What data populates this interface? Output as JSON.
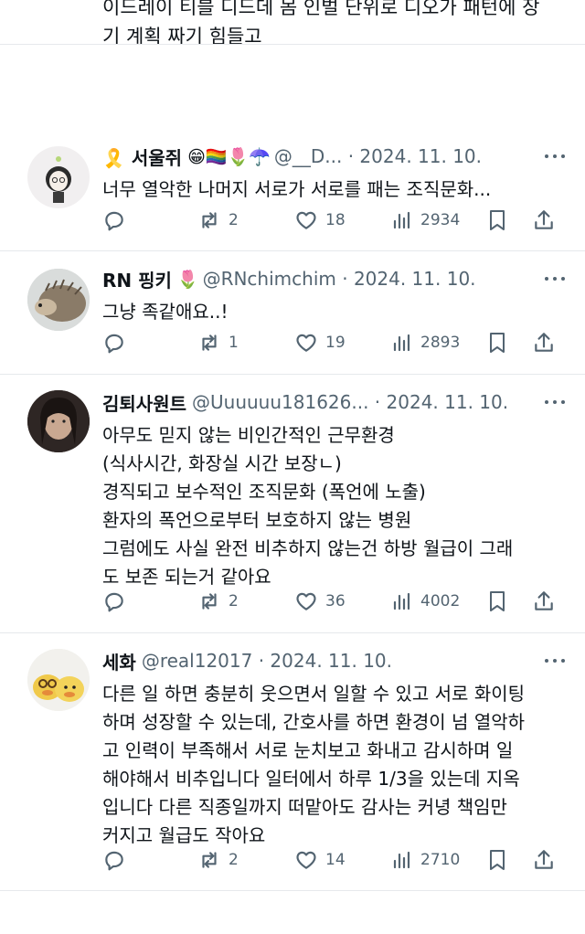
{
  "top_fragment": {
    "line1": "이드레이 티블 디드데 몸 인벌 단위로 디오가 패턴에 장",
    "line2": "기 계획 짜기 힘들고"
  },
  "tweets": [
    {
      "display_name": "🎗️ 서울쥐",
      "emojis": "😁🏳️‍🌈🌷☂️",
      "handle": "@__D...",
      "date": "2024. 11. 10.",
      "text": "너무 열악한 나머지 서로가 서로를 패는 조직문화...",
      "retweets": "2",
      "likes": "18",
      "views": "2934"
    },
    {
      "display_name": "RN 핑키",
      "emojis": "🌷",
      "handle": "@RNchimchim",
      "date": "2024. 11. 10.",
      "text": "그냥 족같애요..!",
      "retweets": "1",
      "likes": "19",
      "views": "2893"
    },
    {
      "display_name": "김퇴사원트",
      "emojis": "",
      "handle": "@Uuuuuu181626...",
      "date": "2024. 11. 10.",
      "text": "아무도 믿지 않는 비인간적인 근무환경\n(식사시간, 화장실 시간 보장ㄴ)\n경직되고 보수적인 조직문화 (폭언에 노출)\n환자의 폭언으로부터 보호하지 않는 병원\n그럼에도 사실 완전 비추하지 않는건 하방 월급이 그래\n도 보존 되는거 같아요",
      "retweets": "2",
      "likes": "36",
      "views": "4002"
    },
    {
      "display_name": "세화",
      "emojis": "",
      "handle": "@real12017",
      "date": "2024. 11. 10.",
      "text": "다른 일 하면 충분히 웃으면서 일할 수 있고 서로 화이팅\n하며 성장할 수 있는데, 간호사를 하면 환경이 넘 열악하\n고 인력이 부족해서 서로 눈치보고 화내고 감시하며 일\n해야해서 비추입니다 일터에서 하루 1/3을 있는데 지옥\n입니다 다른 직종일까지 떠맡아도 감사는 커녕 책임만\n커지고 월급도 작아요",
      "retweets": "2",
      "likes": "14",
      "views": "2710"
    }
  ],
  "icons": {
    "reply": "reply-icon",
    "retweet": "retweet-icon",
    "like": "like-icon",
    "views": "views-icon",
    "bookmark": "bookmark-icon",
    "share": "share-icon",
    "more": "more-icon"
  },
  "colors": {
    "text": "#0f1419",
    "secondary": "#536471",
    "divider": "#e6e9ec"
  }
}
